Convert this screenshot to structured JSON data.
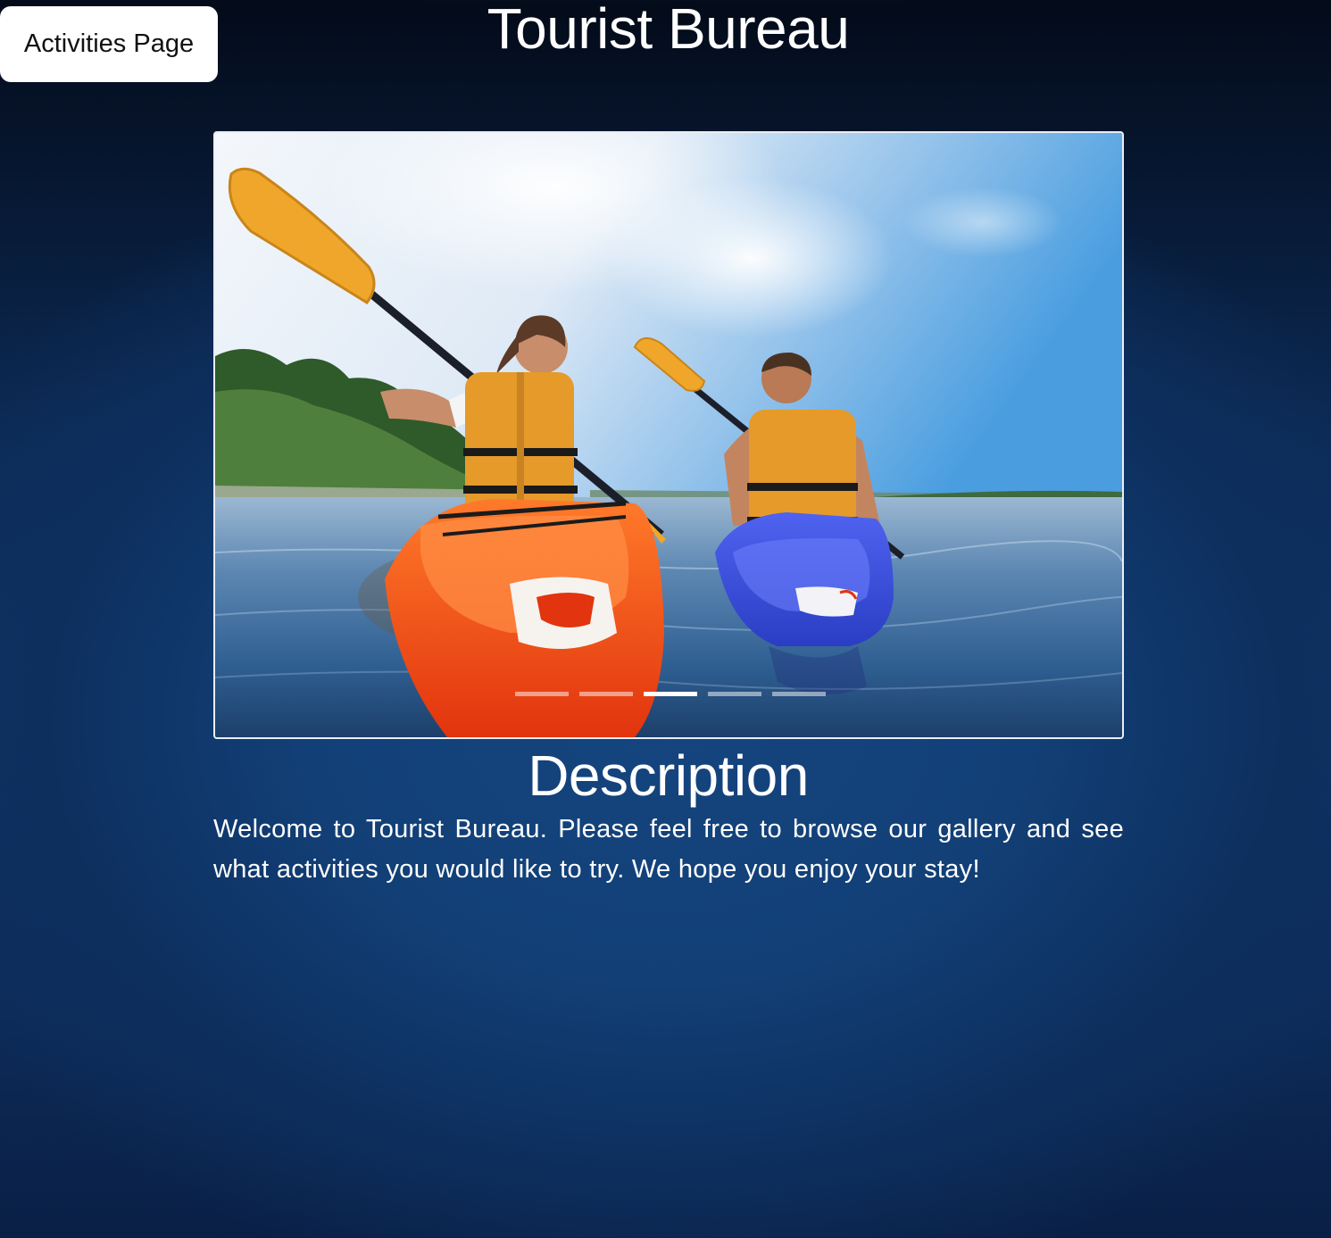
{
  "nav": {
    "activities_label": "Activities Page"
  },
  "header": {
    "title": "Tourist Bureau"
  },
  "carousel": {
    "slide_count": 5,
    "active_index": 2
  },
  "description": {
    "heading": "Description",
    "body": "Welcome to Tourist Bureau. Please feel free to browse our gallery and see what activities you would like to try. We hope you enjoy your stay!"
  }
}
